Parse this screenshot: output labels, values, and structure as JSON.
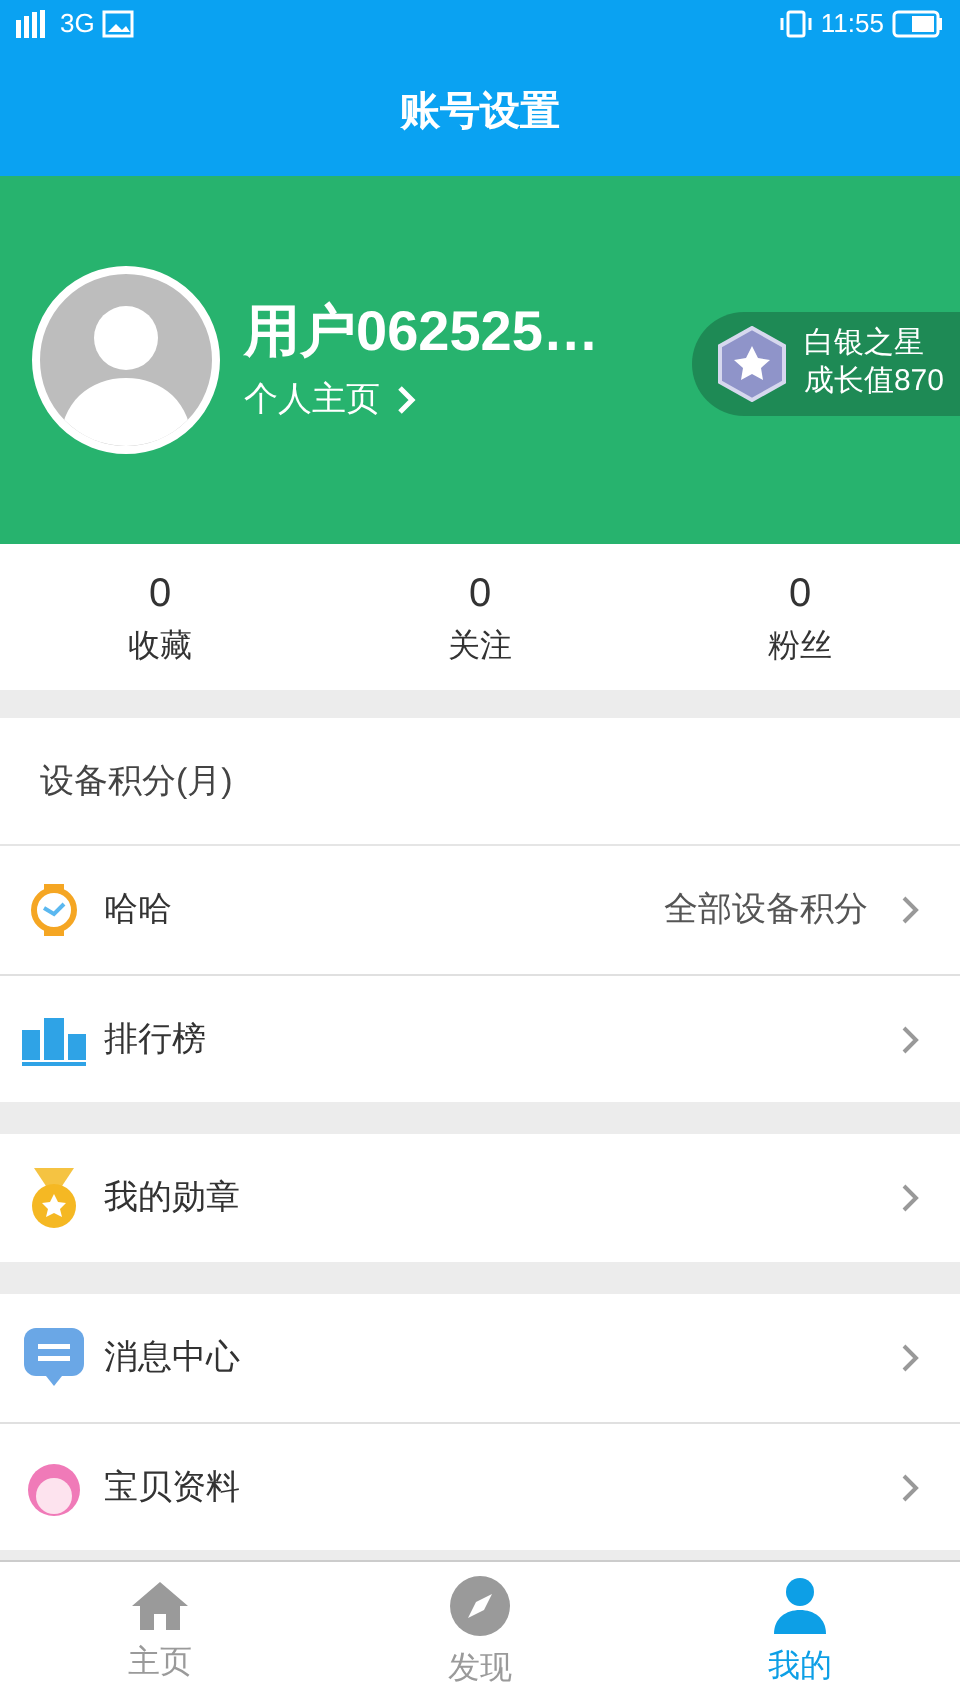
{
  "status_bar": {
    "network": "3G",
    "time": "11:55"
  },
  "header": {
    "title": "账号设置"
  },
  "profile": {
    "name": "用户062525…",
    "link": "个人主页",
    "badge_title": "白银之星",
    "badge_points": "成长值870"
  },
  "stats": [
    {
      "value": "0",
      "label": "收藏"
    },
    {
      "value": "0",
      "label": "关注"
    },
    {
      "value": "0",
      "label": "粉丝"
    }
  ],
  "section_title": "设备积分(月)",
  "groups": [
    [
      {
        "kind": "watch",
        "label": "哈哈",
        "value": "全部设备积分"
      },
      {
        "kind": "ranking",
        "label": "排行榜"
      }
    ],
    [
      {
        "kind": "medal",
        "label": "我的勋章"
      }
    ],
    [
      {
        "kind": "message",
        "label": "消息中心"
      },
      {
        "kind": "baby",
        "label": "宝贝资料"
      }
    ]
  ],
  "tabs": [
    {
      "kind": "home",
      "label": "主页",
      "selected": false
    },
    {
      "kind": "discover",
      "label": "发现",
      "selected": false
    },
    {
      "kind": "me",
      "label": "我的",
      "selected": true
    }
  ]
}
